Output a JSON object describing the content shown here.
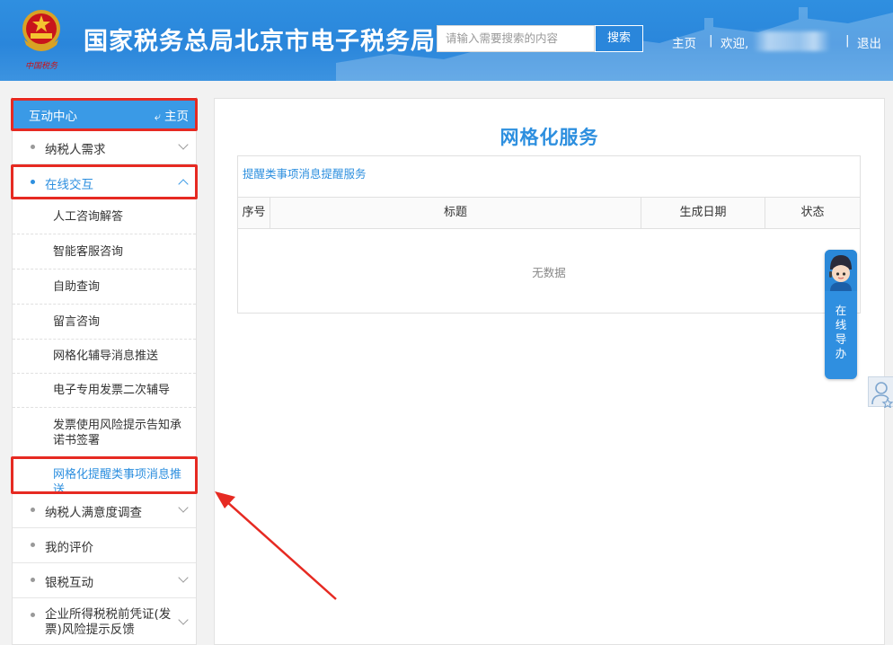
{
  "header": {
    "site_title": "国家税务总局北京市电子税务局",
    "search_placeholder": "请输入需要搜索的内容",
    "search_button": "搜索",
    "nav_home": "主页",
    "separator": "|",
    "welcome": "欢迎,",
    "logout": "退出",
    "logo_caption": "中国税务"
  },
  "sidebar": {
    "header_title": "互动中心",
    "home_link": "主页",
    "items": [
      {
        "label": "纳税人需求",
        "expanded": false
      },
      {
        "label": "在线交互",
        "expanded": true
      },
      {
        "label": "纳税人满意度调查",
        "expanded": false
      },
      {
        "label": "我的评价",
        "expanded": false
      },
      {
        "label": "银税互动",
        "expanded": false
      },
      {
        "label": "企业所得税税前凭证(发票)风险提示反馈",
        "expanded": false
      }
    ],
    "sub_items": [
      "人工咨询解答",
      "智能客服咨询",
      "自助查询",
      "留言咨询",
      "网格化辅导消息推送",
      "电子专用发票二次辅导",
      "发票使用风险提示告知承诺书签署",
      "网格化提醒类事项消息推送"
    ]
  },
  "main": {
    "title": "网格化服务",
    "panel_title": "提醒类事项消息提醒服务",
    "columns": [
      "序号",
      "标题",
      "生成日期",
      "状态"
    ],
    "empty_text": "无数据"
  },
  "float_guide": {
    "chars": [
      "在",
      "线",
      "导",
      "办"
    ]
  },
  "colors": {
    "header_blue": "#2a86db",
    "accent_blue": "#2d8fdf",
    "highlight_red": "#e62a22"
  }
}
